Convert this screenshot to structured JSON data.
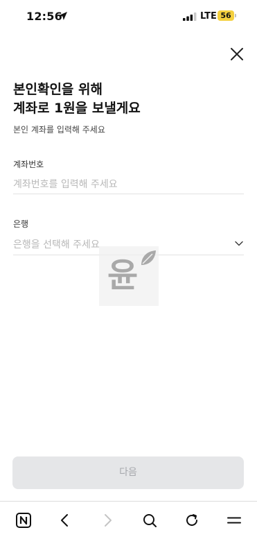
{
  "status_bar": {
    "time": "12:56",
    "network": "LTE",
    "battery": "56",
    "battery_color": "#f4d03f"
  },
  "header": {
    "close_icon": "close-icon"
  },
  "content": {
    "title_line1": "본인확인을 위해",
    "title_line2": "계좌로 1원을 보낼게요",
    "subtitle": "본인 계좌를 입력해 주세요",
    "account_field": {
      "label": "계좌번호",
      "placeholder": "계좌번호를 입력해 주세요",
      "value": ""
    },
    "bank_field": {
      "label": "은행",
      "placeholder": "은행을 선택해 주세요"
    }
  },
  "watermark": {
    "char": "윤"
  },
  "actions": {
    "next_label": "다음",
    "next_enabled": false
  },
  "browser_nav": {
    "icons": [
      "naver-home-icon",
      "back-icon",
      "forward-icon",
      "search-icon",
      "refresh-icon",
      "menu-icon"
    ]
  }
}
